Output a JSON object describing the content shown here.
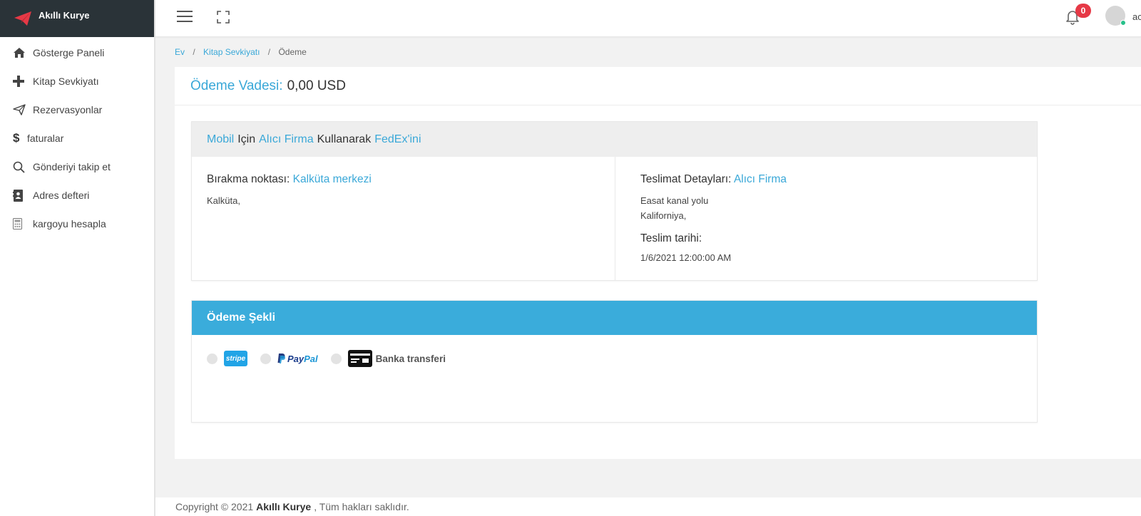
{
  "brand": {
    "name": "Akıllı Kurye"
  },
  "sidebar": {
    "items": [
      {
        "label": "Gösterge Paneli",
        "icon": "home-icon"
      },
      {
        "label": "Kitap Sevkiyatı",
        "icon": "plus-icon"
      },
      {
        "label": "Rezervasyonlar",
        "icon": "paper-plane-icon"
      },
      {
        "label": "faturalar",
        "icon": "dollar-icon"
      },
      {
        "label": "Gönderiyi takip et",
        "icon": "search-icon"
      },
      {
        "label": "Adres defteri",
        "icon": "address-book-icon"
      },
      {
        "label": "kargoyu hesapla",
        "icon": "calculator-icon"
      }
    ]
  },
  "topbar": {
    "notification_count": "0",
    "username": "ac"
  },
  "breadcrumb": {
    "items": [
      "Ev",
      "Kitap Sevkiyatı",
      "Ödeme"
    ]
  },
  "payment_due": {
    "label": "Ödeme Vadesi:",
    "value": "0,00 USD"
  },
  "shipment": {
    "title": {
      "service": "Mobil",
      "word1": "Için",
      "receiver": "Alıcı Firma",
      "word2": "Kullanarak",
      "carrier": "FedEx'ini"
    },
    "pickup": {
      "label": "Bırakma noktası:",
      "name": "Kalküta merkezi",
      "address": "Kalküta,"
    },
    "delivery": {
      "label": "Teslimat Detayları:",
      "name": "Alıcı Firma",
      "address_line1": "Easat kanal yolu",
      "address_line2": "Kaliforniya,",
      "date_label": "Teslim tarihi:",
      "date": "1/6/2021 12:00:00 AM"
    }
  },
  "payment_methods": {
    "title": "Ödeme Şekli",
    "stripe": "stripe",
    "paypal_p": "Pay",
    "paypal_pal": "Pal",
    "bank": "Banka transferi"
  },
  "footer": {
    "prefix": "Copyright © 2021",
    "brand": "Akıllı Kurye",
    "suffix": ", Tüm hakları saklıdır."
  },
  "colors": {
    "accent": "#3aa8d8",
    "sidebar_dark": "#2a3338",
    "badge": "#e63946",
    "payment_header": "#3aacdb"
  }
}
